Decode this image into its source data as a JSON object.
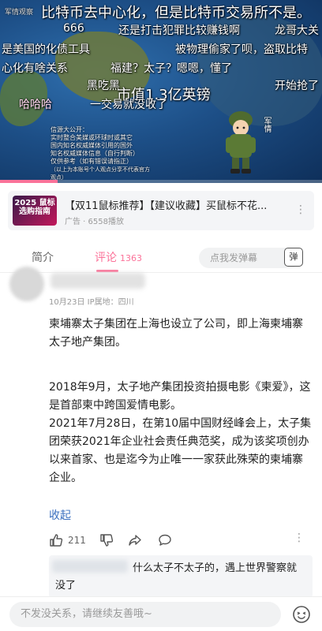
{
  "video": {
    "channel_label": "军情观察",
    "danmaku": [
      "比特币去中心化，但是比特币交易所不是。",
      "666",
      "还是打击犯罪比较赚钱啊",
      "龙哥大关",
      "是美国的化债工具",
      "被物理偷家了呗，盗取比特",
      "心化有啥关系",
      "福建？太子？嗯嗯，懂了",
      "黑吃黑",
      "开始抢了",
      "市值1.3亿英镑",
      "哈哈哈",
      "一交易就没收了"
    ],
    "info_text": [
      "信源大公开：",
      "实时整合美媒或环球时或其它",
      "国内知名权威媒体引用的国外",
      "知名权威媒体信息（自行判断）",
      "仅供参考（如有错误请指正）",
      "（以上为本账号个人观点分享不代表官方观点）"
    ],
    "soldier_text": "军情",
    "progress": 0.18
  },
  "ad": {
    "thumb_text": "2025 鼠标选购指南",
    "title": "【双11鼠标推荐】【建议收藏】买鼠标不花...",
    "meta": "广告 · 6558播放"
  },
  "tabs": {
    "intro": "简介",
    "comments": "评论",
    "comments_count": "1363",
    "danmaku_placeholder": "点我发弹幕",
    "danmaku_toggle": "弹"
  },
  "comment": {
    "meta": "10月23日 IP属地：四川",
    "paragraphs": [
      "柬埔寨太子集团在上海也设立了公司，即上海柬埔寨太子地产集团。",
      "2018年9月，太子地产集团投资拍摄电影《柬爱》，这是首部柬中跨国爱情电影。",
      "2021年7月28日，在第10届中国财经峰会上，太子集团荣获2021年企业社会责任典范奖，成为该奖项创办以来首家、也是迄今为止唯一一家获此殊荣的柬埔寨企业。"
    ],
    "collapse": "收起",
    "like_count": "211"
  },
  "reply": {
    "text": "什么太子不太子的，遇上世界警察就没了"
  },
  "bottom": {
    "placeholder": "不发没关系，请继续友善哦~"
  },
  "colors": {
    "accent": "#fb7299",
    "link": "#3a6fbf"
  }
}
